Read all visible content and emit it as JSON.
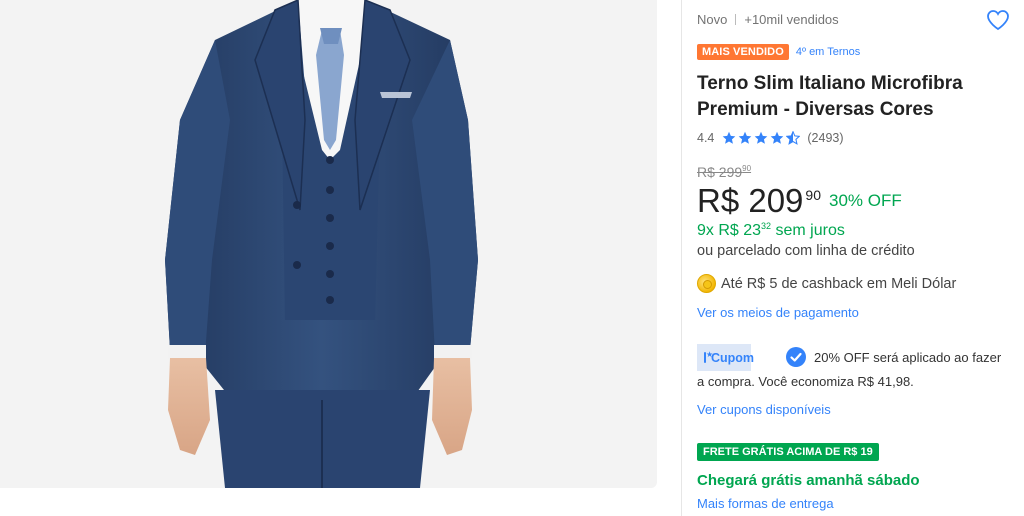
{
  "product": {
    "condition": "Novo",
    "sold": "+10mil vendidos",
    "best_seller_badge": "MAIS VENDIDO",
    "rank_link": "4º em Ternos",
    "title": "Terno Slim Italiano Microfibra Premium - Diversas Cores",
    "rating": {
      "score": "4.4",
      "stars": 4.5,
      "reviews": "(2493)"
    }
  },
  "pricing": {
    "old_price": "R$ 299",
    "old_cents": "90",
    "price": "R$ 209",
    "price_cents": "90",
    "discount": "30% OFF",
    "installments": "9x R$ 23",
    "installment_cents": "32",
    "installment_suffix": " sem juros",
    "credit_text": "ou parcelado com linha de crédito",
    "cashback": "Até R$ 5 de cashback em Meli Dólar",
    "payment_link": "Ver os meios de pagamento"
  },
  "coupon": {
    "label": "Cupom",
    "text_line1": "20% OFF será aplicado ao fazer",
    "text_line2": "a compra. Você economiza R$ 41,98.",
    "link": "Ver cupons disponíveis"
  },
  "shipping": {
    "badge": "FRETE GRÁTIS ACIMA DE R$ 19",
    "arrival": "Chegará grátis amanhã sábado",
    "more_link": "Mais formas de entrega"
  },
  "colors": {
    "accent_blue": "#3483fa",
    "green": "#00a650",
    "orange_badge": "#ff7733",
    "suit": "#2e4a78"
  },
  "icons": {
    "favorite": "heart-outline-icon",
    "star": "star-icon",
    "coin": "meli-dolar-coin-icon",
    "coupon": "ticket-icon",
    "check": "check-circle-icon"
  }
}
